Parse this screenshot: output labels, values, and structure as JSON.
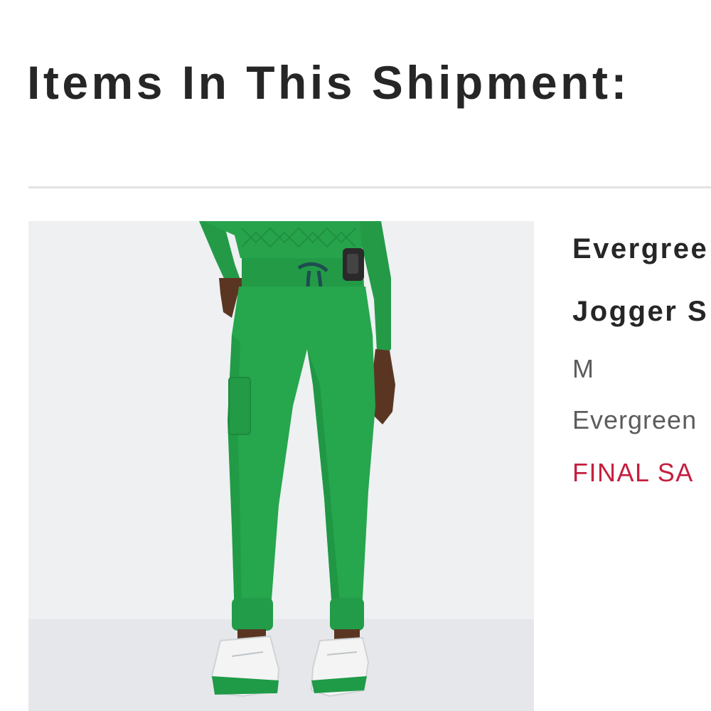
{
  "shipment": {
    "heading": "Items In This Shipment:"
  },
  "item": {
    "name_line_1": "Evergree",
    "name_line_2": "Jogger S",
    "size": "M",
    "color": "Evergreen",
    "status": "FINAL SA",
    "status_color": "#c4203e"
  },
  "icons": {
    "product_image": "green-jogger-scrub-pants-photo"
  }
}
